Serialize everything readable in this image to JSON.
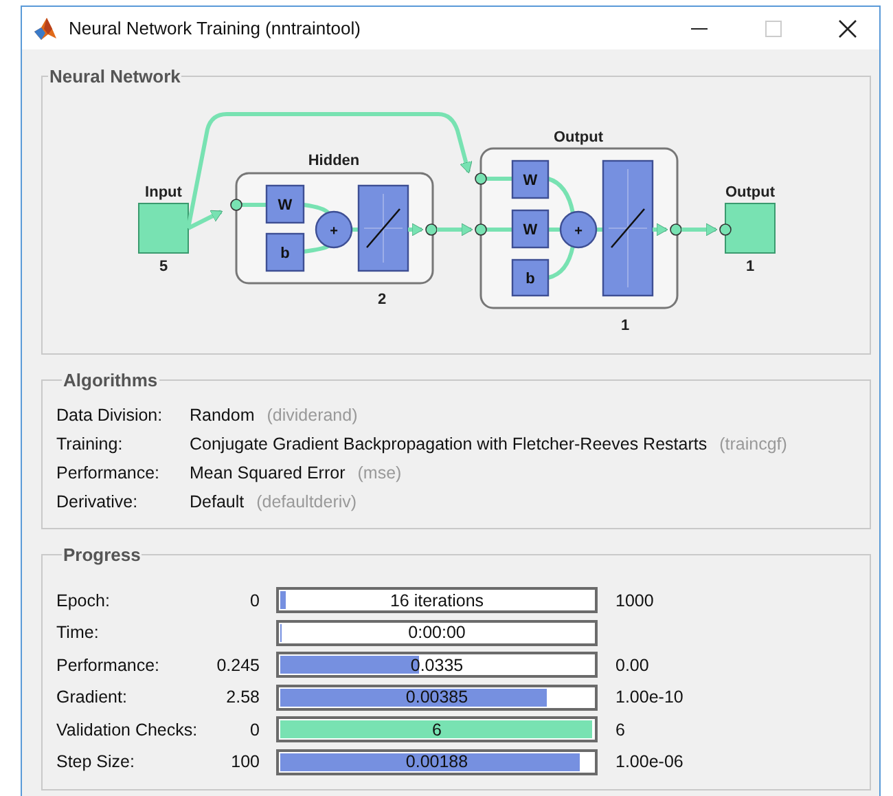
{
  "window": {
    "title": "Neural Network Training (nntraintool)",
    "maximize_disabled": true
  },
  "network": {
    "title": "Neural Network",
    "input": {
      "label": "Input",
      "size": "5"
    },
    "layers": [
      {
        "name": "Hidden",
        "size": "2",
        "weights": [
          "W"
        ],
        "bias": "b",
        "sum": "+"
      },
      {
        "name": "Output",
        "size": "1",
        "weights": [
          "W",
          "W"
        ],
        "bias": "b",
        "sum": "+"
      }
    ],
    "output": {
      "label": "Output",
      "size": "1"
    }
  },
  "algorithms": {
    "title": "Algorithms",
    "rows": [
      {
        "label": "Data Division:",
        "value": "Random",
        "function": "(dividerand)"
      },
      {
        "label": "Training:",
        "value": "Conjugate Gradient Backpropagation with Fletcher-Reeves Restarts",
        "function": "(traincgf)"
      },
      {
        "label": "Performance:",
        "value": "Mean Squared Error",
        "function": "(mse)"
      },
      {
        "label": "Derivative:",
        "value": "Default",
        "function": "(defaultderiv)"
      }
    ]
  },
  "progress": {
    "title": "Progress",
    "rows": [
      {
        "label": "Epoch:",
        "min": "0",
        "value": "16 iterations",
        "max": "1000",
        "level": 0.016,
        "kind": "measure"
      },
      {
        "label": "Time:",
        "value": "0:00:00",
        "level": 0,
        "kind": "measure"
      },
      {
        "label": "Performance:",
        "min": "0.245",
        "value": "0.0335",
        "max": "0.00",
        "level": 0.445,
        "kind": "measure"
      },
      {
        "label": "Gradient:",
        "min": "2.58",
        "value": "0.00385",
        "max": "1.00e-10",
        "level": 0.85,
        "kind": "measure"
      },
      {
        "label": "Validation Checks:",
        "min": "0",
        "value": "6",
        "max": "6",
        "level": 0.995,
        "kind": "count"
      },
      {
        "label": "Step Size:",
        "min": "100",
        "value": "0.00188",
        "max": "1.00e-06",
        "level": 0.955,
        "kind": "measure"
      }
    ]
  }
}
